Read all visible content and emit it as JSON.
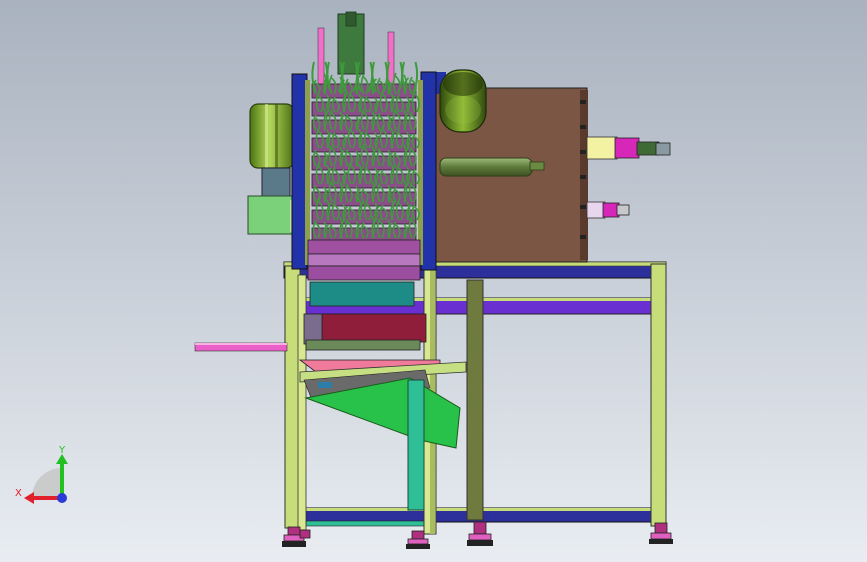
{
  "viewport": {
    "background_top": "#a9b2bf",
    "background_bottom": "#e9edf2"
  },
  "triad": {
    "x_label": "X",
    "y_label": "Y",
    "x_color": "#e0202a",
    "y_color": "#22c022",
    "z_color": "#2a3ad8"
  },
  "colors": {
    "frame": "#c6dd7a",
    "frame_dark": "#8fa04a",
    "rail": "#2d2f9a",
    "rail_blue": "#2233aa",
    "cabinet": "#7b5644",
    "motor": "#6e9a22",
    "plants": "#3e9a3c",
    "conveyor": "#8a4e88",
    "teal": "#1e8c86",
    "maroon": "#8e1e3a",
    "chute": "#28c24a",
    "pink": "#ea60c8",
    "mint": "#2fbf97",
    "olive": "#6f7a3f",
    "gray_blue": "#5a7a8a"
  }
}
